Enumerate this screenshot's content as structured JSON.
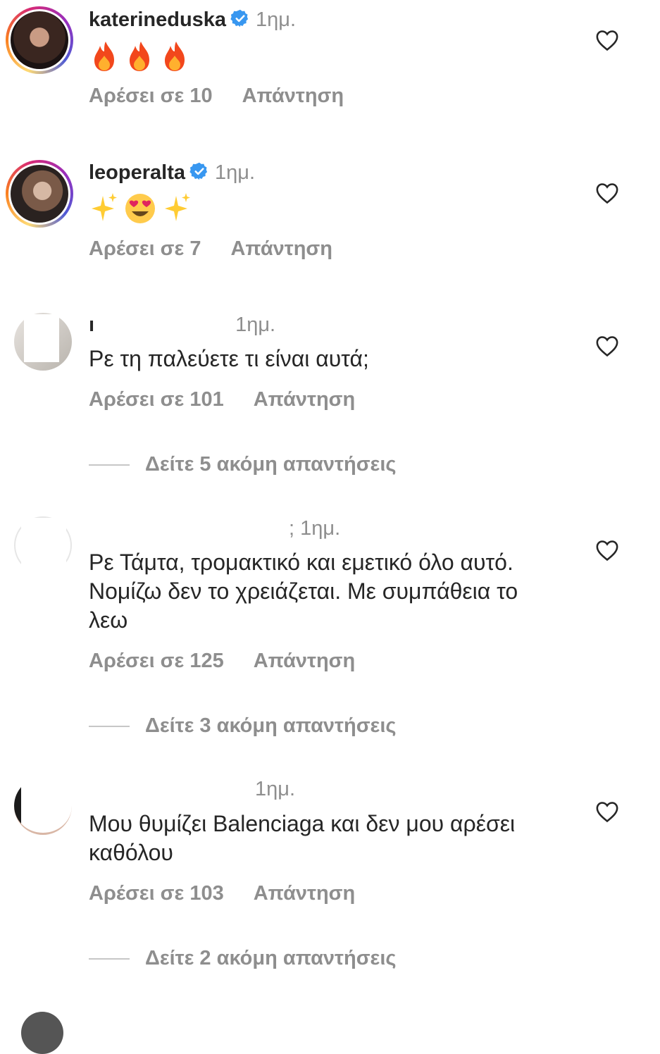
{
  "colors": {
    "primary_text": "#262626",
    "secondary_text": "#8e8e8e",
    "verified_blue": "#3897f0",
    "story_ring": "#d62976"
  },
  "comments": [
    {
      "username": "katerineduska",
      "verified": true,
      "time": "1ημ.",
      "content_type": "emoji",
      "emoji": [
        "fire-icon",
        "fire-icon",
        "fire-icon"
      ],
      "likes_label": "Αρέσει σε 10",
      "reply_label": "Απάντηση"
    },
    {
      "username": "leoperalta",
      "verified": true,
      "time": "1ημ.",
      "content_type": "emoji",
      "emoji": [
        "sparkles-icon",
        "heart-eyes-icon",
        "sparkles-icon"
      ],
      "likes_label": "Αρέσει σε 7",
      "reply_label": "Απάντηση"
    },
    {
      "username": "ı",
      "verified": false,
      "time": "1ημ.",
      "text": "Ρε τη παλεύετε τι είναι αυτά;",
      "likes_label": "Αρέσει σε 101",
      "reply_label": "Απάντηση",
      "more_replies": "Δείτε 5 ακόμη απαντήσεις"
    },
    {
      "username": "",
      "verified": false,
      "time": "; 1ημ.",
      "text": "Ρε Τάμτα, τρομακτικό και εμετικό όλο αυτό. Νομίζω δεν το χρειάζεται. Με συμπάθεια το λεω",
      "likes_label": "Αρέσει σε 125",
      "reply_label": "Απάντηση",
      "more_replies": "Δείτε 3 ακόμη απαντήσεις"
    },
    {
      "username": "",
      "verified": false,
      "time": "1ημ.",
      "text": "Μου θυμίζει Balenciaga και δεν μου αρέσει καθόλου",
      "likes_label": "Αρέσει σε 103",
      "reply_label": "Απάντηση",
      "more_replies": "Δείτε 2 ακόμη απαντήσεις"
    }
  ]
}
